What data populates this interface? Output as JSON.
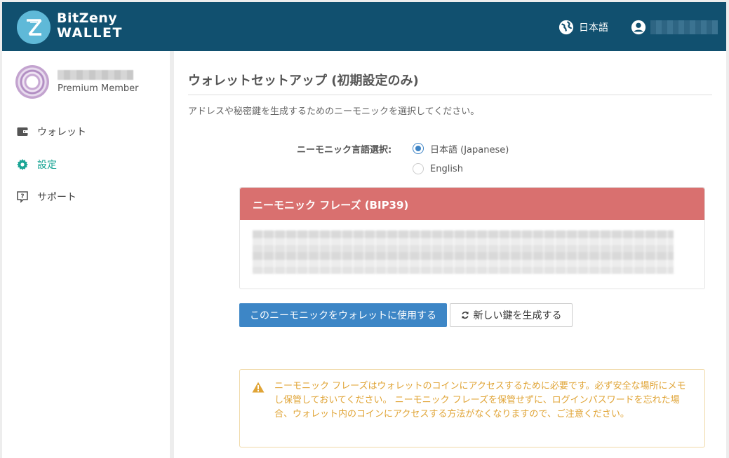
{
  "header": {
    "logo_line1": "BitZeny",
    "logo_line2": "WALLET",
    "language": "日本語"
  },
  "sidebar": {
    "member_level": "Premium Member",
    "items": [
      {
        "label": "ウォレット",
        "icon": "wallet-icon",
        "active": false
      },
      {
        "label": "設定",
        "icon": "gear-icon",
        "active": true
      },
      {
        "label": "サポート",
        "icon": "help-icon",
        "active": false
      }
    ]
  },
  "main": {
    "title": "ウォレットセットアップ (初期設定のみ)",
    "subtitle": "アドレスや秘密鍵を生成するためのニーモニックを選択してください。",
    "lang_label": "ニーモニック言語選択:",
    "lang_options": [
      {
        "label": "日本語 (Japanese)",
        "checked": true
      },
      {
        "label": "English",
        "checked": false
      }
    ],
    "phrase_header": "ニーモニック フレーズ (BIP39)",
    "use_button": "このニーモニックをウォレットに使用する",
    "generate_button": "新しい鍵を生成する",
    "warning": "ニーモニック フレーズはウォレットのコインにアクセスするために必要です。必ず安全な場所にメモし保管しておいてください。 ニーモニック フレーズを保管せずに、ログインパスワードを忘れた場合、ウォレット内のコインにアクセスする方法がなくなりますので、ご注意ください。"
  },
  "colors": {
    "header_bg": "#11506f",
    "accent": "#1aa595",
    "primary": "#3d86c6",
    "danger_header": "#d9706f",
    "warning_text": "#e0a436"
  }
}
